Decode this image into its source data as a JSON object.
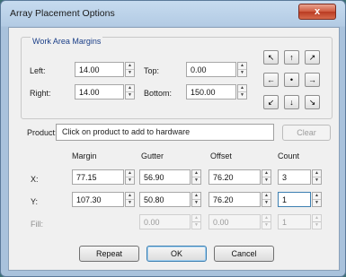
{
  "window": {
    "title": "Array Placement Options",
    "close_symbol": "x"
  },
  "margins": {
    "group_label": "Work Area Margins",
    "left": {
      "label": "Left:",
      "value": "14.00"
    },
    "right": {
      "label": "Right:",
      "value": "14.00"
    },
    "top": {
      "label": "Top:",
      "value": "0.00"
    },
    "bottom": {
      "label": "Bottom:",
      "value": "150.00"
    }
  },
  "spin": {
    "up": "▲",
    "down": "▼"
  },
  "align_buttons": [
    "↖",
    "↑",
    "↗",
    "←",
    "•",
    "→",
    "↙",
    "↓",
    "↘"
  ],
  "product": {
    "label": "Product:",
    "text": "Click on product to add to hardware",
    "clear": "Clear"
  },
  "grid": {
    "headers": {
      "margin": "Margin",
      "gutter": "Gutter",
      "offset": "Offset",
      "count": "Count"
    },
    "x": {
      "label": "X:",
      "margin": "77.15",
      "gutter": "56.90",
      "offset": "76.20",
      "count": "3"
    },
    "y": {
      "label": "Y:",
      "margin": "107.30",
      "gutter": "50.80",
      "offset": "76.20",
      "count": "1"
    },
    "fill": {
      "label": "Fill:",
      "gutter": "0.00",
      "offset": "0.00",
      "count": "1"
    }
  },
  "buttons": {
    "repeat": "Repeat",
    "ok": "OK",
    "cancel": "Cancel"
  }
}
